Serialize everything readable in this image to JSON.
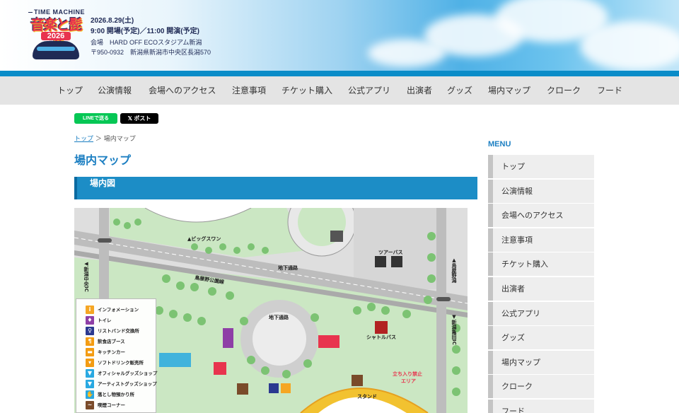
{
  "header": {
    "logo": {
      "top": "TIME MACHINE",
      "main": "音楽と髭達",
      "year": "2026"
    },
    "date": "2026.8.29(土)",
    "time": "9:00 開場(予定)／11:00 開演(予定)",
    "venue": "会場　HARD OFF ECOスタジアム新潟",
    "address": "〒950-0932　新潟県新潟市中央区長潟570"
  },
  "nav": {
    "items": [
      "トップ",
      "公演情報",
      "会場へのアクセス",
      "注意事項",
      "チケット購入",
      "公式アプリ",
      "出演者",
      "グッズ",
      "場内マップ",
      "クローク",
      "フード"
    ]
  },
  "share": {
    "line": "LINEで送る",
    "x": "𝕏 ポスト"
  },
  "breadcrumb": {
    "home": "トップ",
    "separator": "＞",
    "current": "場内マップ"
  },
  "page_title": "場内マップ",
  "section_title": "場内図",
  "map": {
    "labels": {
      "big_swan": "▲ビッグスワン",
      "toyano_park_line": "鳥屋野公園線",
      "underpass_1": "地下通路",
      "underpass_2": "地下通路",
      "tour_bus": "ツアーバス",
      "shuttle_bus": "シャトルバス",
      "no_entry": "立ち入り禁止",
      "no_entry_area": "エリア",
      "stand": "スタンド",
      "niigata_chuo_ic": "◀新潟中央IC",
      "toyanogata": "▲鳥屋野潟",
      "niigata_kameda_ic": "▼新潟亀田IC"
    },
    "legend": [
      {
        "label": "インフォメーション",
        "icon": "info-icon",
        "color": "#f5a623"
      },
      {
        "label": "トイレ",
        "icon": "toilet-icon",
        "color": "#8e3fa6"
      },
      {
        "label": "リストバンド交換所",
        "icon": "wristband-icon",
        "color": "#2b3990"
      },
      {
        "label": "飲食店ブース",
        "icon": "food-icon",
        "color": "#f39c12"
      },
      {
        "label": "キッチンカー",
        "icon": "kitchen-car-icon",
        "color": "#f39c12"
      },
      {
        "label": "ソフトドリンク販売所",
        "icon": "drink-icon",
        "color": "#f39c12"
      },
      {
        "label": "オフィシャルグッズショップ",
        "icon": "official-goods-icon",
        "color": "#29a9e1"
      },
      {
        "label": "アーティストグッズショップ",
        "icon": "artist-goods-icon",
        "color": "#29a9e1"
      },
      {
        "label": "落とし物預かり所",
        "icon": "lost-found-icon",
        "color": "#29a9e1"
      },
      {
        "label": "喫煙コーナー",
        "icon": "smoking-icon",
        "color": "#7a4b2a"
      }
    ]
  },
  "sidebar": {
    "heading": "MENU",
    "items": [
      "トップ",
      "公演情報",
      "会場へのアクセス",
      "注意事項",
      "チケット購入",
      "出演者",
      "公式アプリ",
      "グッズ",
      "場内マップ",
      "クローク",
      "フード"
    ]
  },
  "colors": {
    "accent": "#1c8dc6",
    "nav_bg": "#e4e4e4",
    "map_green": "#7cc373",
    "road": "#b7b7b7"
  }
}
